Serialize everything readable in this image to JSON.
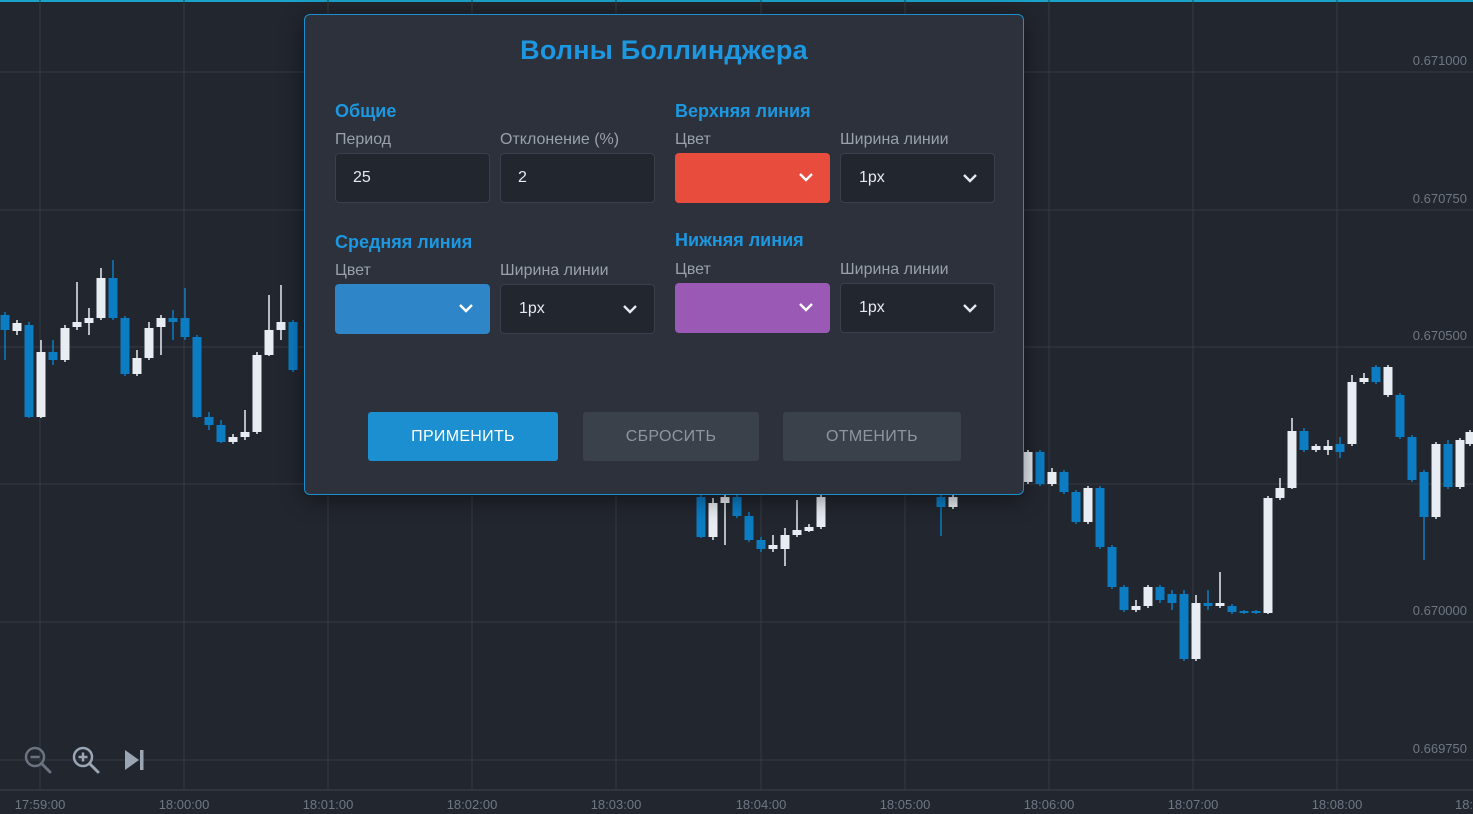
{
  "chart": {
    "x_ticks": [
      "17:59:00",
      "18:00:00",
      "18:01:00",
      "18:02:00",
      "18:03:00",
      "18:04:00",
      "18:05:00",
      "18:06:00",
      "18:07:00",
      "18:08:00",
      "18:"
    ],
    "y_ticks": [
      "0.671000",
      "0.670750",
      "0.670500",
      "0.670000",
      "0.669750"
    ],
    "colors": {
      "up": "#e8edf3",
      "down": "#0c7cc3",
      "grid": "#363b45",
      "background": "#22262e"
    }
  },
  "zoom": {
    "zoom_out_icon": "zoom-out-icon",
    "zoom_in_icon": "zoom-in-icon",
    "jump_end_icon": "skip-to-end-icon"
  },
  "dialog": {
    "title": "Волны Боллинджера",
    "general": {
      "title": "Общие",
      "period_label": "Период",
      "period_value": "25",
      "deviation_label": "Отклонение (%)",
      "deviation_value": "2"
    },
    "upper": {
      "title": "Верхняя линия",
      "color_label": "Цвет",
      "color": "#e84c3d",
      "width_label": "Ширина линии",
      "width_value": "1px"
    },
    "middle": {
      "title": "Средняя линия",
      "color_label": "Цвет",
      "color": "#2e86c8",
      "width_label": "Ширина линии",
      "width_value": "1px"
    },
    "lower": {
      "title": "Нижняя линия",
      "color_label": "Цвет",
      "color": "#9b59b6",
      "width_label": "Ширина линии",
      "width_value": "1px"
    },
    "buttons": {
      "apply": "ПРИМЕНИТЬ",
      "reset": "СБРОСИТЬ",
      "cancel": "ОТМЕНИТЬ"
    },
    "accent_color": "#1c97e0"
  }
}
